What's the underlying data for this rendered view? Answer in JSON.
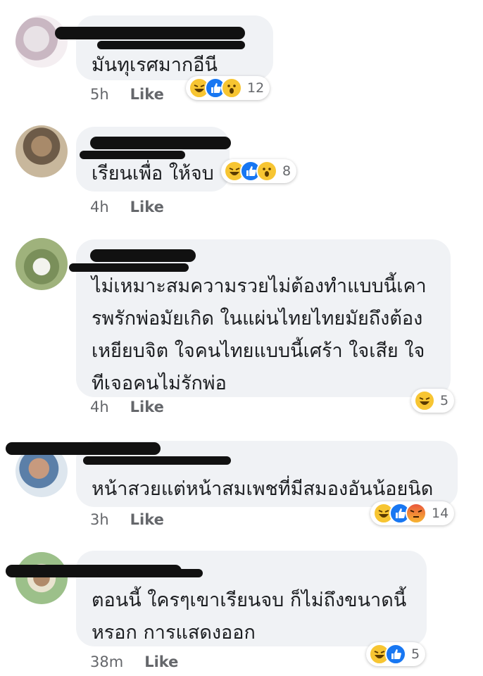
{
  "comments": [
    {
      "text": "มันทุเรศมากอีนี",
      "time": "5h",
      "like_label": "Like",
      "reactions": [
        "haha",
        "like",
        "wow"
      ],
      "reaction_count": "12"
    },
    {
      "text": "เรียนเพื่อ ให้จบ",
      "time": "4h",
      "like_label": "Like",
      "reactions": [
        "haha",
        "like",
        "wow"
      ],
      "reaction_count": "8"
    },
    {
      "text": "ไม่เหมาะสมความรวยไม่ต้องทำแบบนี้เคา\nรพรักพ่อมัยเกิด ในแผ่นไทยไทยมัยถึงต้อง\nเหยียบจิต ใจคนไทยแบบนี้เศร้า ใจเสีย ใจ\nทีเจอคนไม่รักพ่อ",
      "time": "4h",
      "like_label": "Like",
      "reactions": [
        "haha"
      ],
      "reaction_count": "5"
    },
    {
      "text": "หน้าสวยแต่หน้าสมเพชที่มีสมองอันน้อยนิด",
      "time": "3h",
      "like_label": "Like",
      "reactions": [
        "haha",
        "like",
        "angry"
      ],
      "reaction_count": "14"
    },
    {
      "text": "ตอนนี้ ใครๆเขาเรียนจบ  ก็ไม่ถึงขนาดนี้\nหรอก  การแสดงออก",
      "time": "38m",
      "like_label": "Like",
      "reactions": [
        "haha",
        "like"
      ],
      "reaction_count": "5"
    }
  ],
  "colors": {
    "bubble": "#f0f2f5",
    "meta_text": "#65676b",
    "like_blue": "#1877f2",
    "haha_yellow": "#f7c532"
  },
  "icons": {
    "haha": "haha-reaction-icon",
    "like": "like-reaction-icon",
    "wow": "wow-reaction-icon",
    "angry": "angry-reaction-icon"
  }
}
